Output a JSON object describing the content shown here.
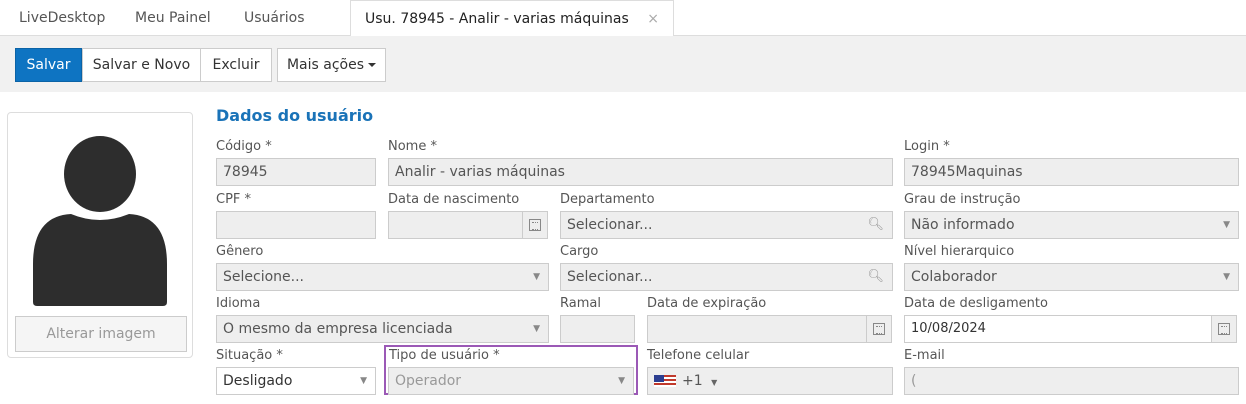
{
  "tabs": {
    "t1": "LiveDesktop",
    "t2": "Meu Painel",
    "t3": "Usuários",
    "active": "Usu. 78945 - Analir - varias máquinas",
    "close": "×"
  },
  "toolbar": {
    "save": "Salvar",
    "save_new": "Salvar e Novo",
    "delete": "Excluir",
    "more": "Mais ações"
  },
  "avatar": {
    "change": "Alterar imagem"
  },
  "section": {
    "title": "Dados do usuário"
  },
  "form": {
    "codigo_label": "Código *",
    "codigo": "78945",
    "nome_label": "Nome *",
    "nome": "Analir  - varias máquinas",
    "login_label": "Login *",
    "login": "78945Maquinas",
    "cpf_label": "CPF *",
    "nasc_label": "Data de nascimento",
    "depto_label": "Departamento",
    "depto_placeholder": "Selecionar...",
    "grau_label": "Grau de instrução",
    "grau": "Não informado",
    "genero_label": "Gênero",
    "genero": "Selecione...",
    "cargo_label": "Cargo",
    "cargo_placeholder": "Selecionar...",
    "nivel_label": "Nível hierarquico",
    "nivel": "Colaborador",
    "idioma_label": "Idioma",
    "idioma": "O mesmo da empresa licenciada",
    "ramal_label": "Ramal",
    "expiracao_label": "Data de expiração",
    "deslig_label": "Data de desligamento",
    "deslig": "10/08/2024",
    "situacao_label": "Situação *",
    "situacao": "Desligado",
    "tipo_label": "Tipo de usuário *",
    "tipo": "Operador",
    "telefone_label": "Telefone celular",
    "telefone_code": "+1",
    "email_label": "E-mail",
    "email": "("
  },
  "icons": {
    "dropdown": "▼",
    "search": "🔍︎",
    "calendar": "calendar-icon",
    "flag": "us-flag-icon"
  },
  "colors": {
    "primary": "#0e74c2",
    "section_title": "#1a73b8",
    "highlight": "#9b59b6"
  }
}
